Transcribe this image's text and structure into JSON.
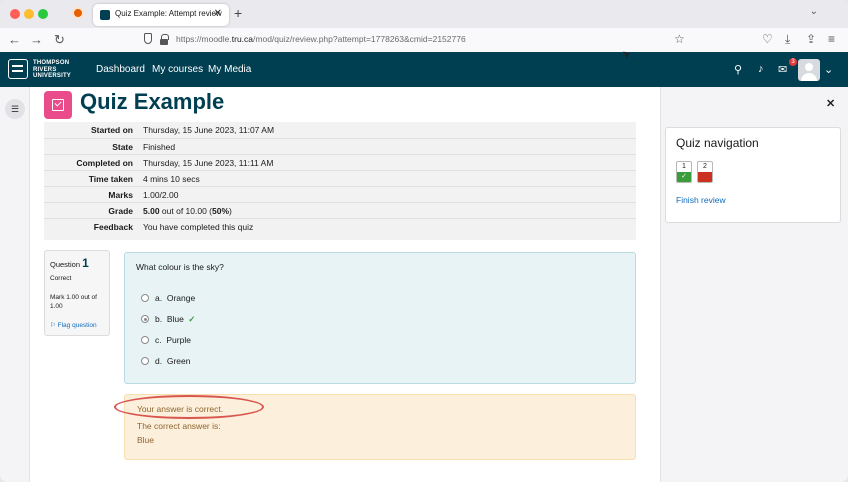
{
  "browser": {
    "tab_title": "Quiz Example: Attempt review",
    "url_prefix": "https://moodle.",
    "url_domain": "tru.ca",
    "url_path": "/mod/quiz/review.php?attempt=1778263&cmid=2152776"
  },
  "header": {
    "logo_line1": "THOMPSON",
    "logo_line2": "RIVERS",
    "logo_line3": "UNIVERSITY",
    "nav": [
      "Dashboard",
      "My courses",
      "My Media"
    ],
    "notification_count": "3"
  },
  "page": {
    "title": "Quiz Example"
  },
  "summary": [
    {
      "label": "Started on",
      "value": "Thursday, 15 June 2023, 11:07 AM"
    },
    {
      "label": "State",
      "value": "Finished"
    },
    {
      "label": "Completed on",
      "value": "Thursday, 15 June 2023, 11:11 AM"
    },
    {
      "label": "Time taken",
      "value": "4 mins 10 secs"
    },
    {
      "label": "Marks",
      "value": "1.00/2.00"
    },
    {
      "label": "Grade",
      "value_bold": "5.00",
      "value_mid": " out of 10.00 (",
      "value_pct": "50%",
      "value_end": ")"
    },
    {
      "label": "Feedback",
      "value": "You have completed this quiz"
    }
  ],
  "question": {
    "label": "Question",
    "number": "1",
    "state": "Correct",
    "mark": "Mark 1.00 out of 1.00",
    "flag": "Flag question",
    "text": "What colour is the sky?",
    "answers": [
      {
        "letter": "a.",
        "text": "Orange",
        "selected": false
      },
      {
        "letter": "b.",
        "text": "Blue",
        "selected": true
      },
      {
        "letter": "c.",
        "text": "Purple",
        "selected": false
      },
      {
        "letter": "d.",
        "text": "Green",
        "selected": false
      }
    ],
    "feedback_1": "Your answer is correct.",
    "feedback_2": "The correct answer is:",
    "feedback_3": "Blue"
  },
  "quiz_navigation": {
    "title": "Quiz navigation",
    "buttons": [
      {
        "num": "1",
        "status": "correct",
        "color": "#3a9c3a"
      },
      {
        "num": "2",
        "status": "incorrect",
        "color": "#ca3120"
      }
    ],
    "finish_review": "Finish review"
  },
  "colors": {
    "header_bg": "#003e51",
    "quiz_icon": "#ea4b8a",
    "question_bg": "#e7f3f5",
    "feedback_bg": "#fcefdc",
    "annotation": "#d9564e"
  }
}
